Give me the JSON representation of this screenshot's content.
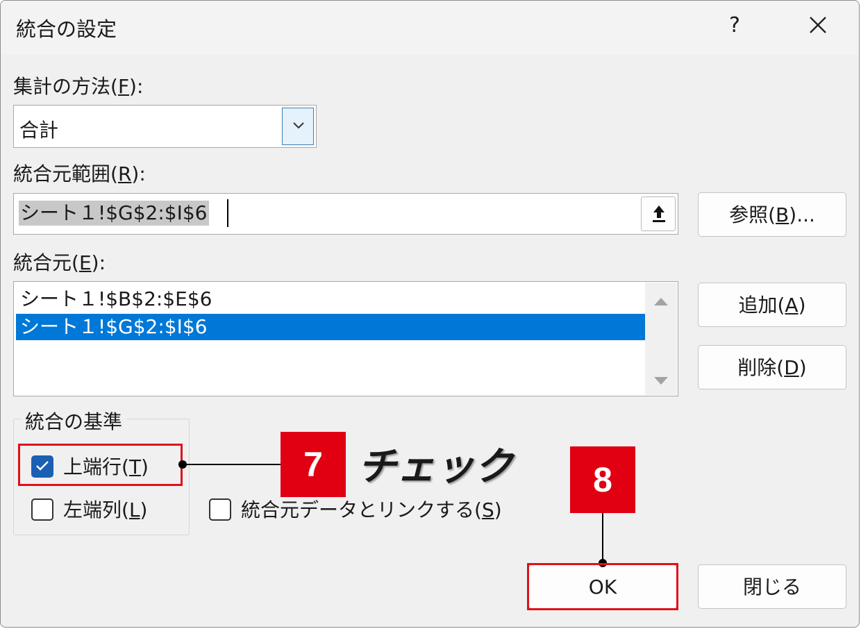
{
  "dialog": {
    "title": "統合の設定",
    "help_label": "?"
  },
  "function": {
    "label_prefix": "集計の方法(",
    "label_key": "F",
    "label_suffix": "):",
    "selected": "合計"
  },
  "reference": {
    "label_prefix": "統合元範囲(",
    "label_key": "R",
    "label_suffix": "):",
    "value": "シート１!$G$2:$I$6"
  },
  "browse_button": {
    "prefix": "参照(",
    "key": "B",
    "suffix": ")..."
  },
  "sources": {
    "label_prefix": "統合元(",
    "label_key": "E",
    "label_suffix": "):",
    "items": [
      "シート１!$B$2:$E$6",
      "シート１!$G$2:$I$6"
    ],
    "selected_index": 1
  },
  "add_button": {
    "prefix": "追加(",
    "key": "A",
    "suffix": ")"
  },
  "delete_button": {
    "prefix": "削除(",
    "key": "D",
    "suffix": ")"
  },
  "labels_group": {
    "title": "統合の基準",
    "top_row": {
      "prefix": "上端行(",
      "key": "T",
      "suffix": ")",
      "checked": true
    },
    "left_column": {
      "prefix": "左端列(",
      "key": "L",
      "suffix": ")",
      "checked": false
    }
  },
  "link_source": {
    "prefix": "統合元データとリンクする(",
    "key": "S",
    "suffix": ")",
    "checked": false
  },
  "ok_button": {
    "label": "OK"
  },
  "close_button": {
    "label": "閉じる"
  },
  "annotations": {
    "step7": "7",
    "step7_note": "チェック",
    "step8": "8",
    "highlight_color": "#e0101a",
    "badge_color": "#e00012"
  },
  "colors": {
    "selection": "#0078d7",
    "checkbox_checked": "#1a5fb4"
  }
}
